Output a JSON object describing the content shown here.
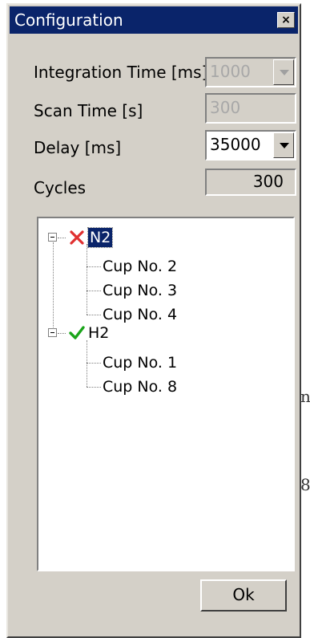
{
  "background_glyphs": [
    "n",
    "8"
  ],
  "window": {
    "title": "Configuration",
    "close_glyph": "×"
  },
  "form": {
    "integration_time_label": "Integration Time [ms]",
    "integration_time_value": "1000",
    "scan_time_label": "Scan Time [s]",
    "scan_time_value": "300",
    "delay_label": "Delay [ms]",
    "delay_value": "35000",
    "cycles_label": "Cycles",
    "cycles_value": "300"
  },
  "tree": {
    "groups": [
      {
        "name": "N2",
        "status": "error",
        "status_icon": "red-x-icon",
        "selected": true,
        "children": [
          "Cup No. 2",
          "Cup No. 3",
          "Cup No. 4"
        ]
      },
      {
        "name": "H2",
        "status": "ok",
        "status_icon": "green-check-icon",
        "selected": false,
        "children": [
          "Cup No. 1",
          "Cup No. 8"
        ]
      }
    ]
  },
  "buttons": {
    "ok_label": "Ok"
  },
  "colors": {
    "title_bar": "#0a246a",
    "dialog_face": "#d4d0c8",
    "error_mark": "#e03030",
    "ok_mark": "#1aa51a",
    "selection": "#0a246a"
  }
}
